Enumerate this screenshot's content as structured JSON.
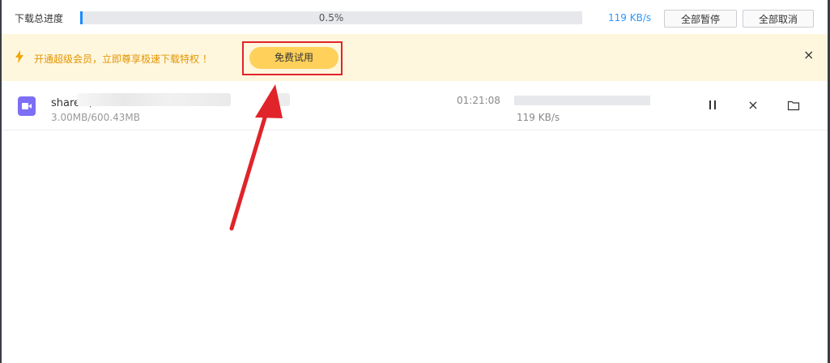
{
  "topbar": {
    "progress_label": "下载总进度",
    "progress_text": "0.5%",
    "progress_value": 0.005,
    "speed": "119 KB/s",
    "pause_all": "全部暂停",
    "cancel_all": "全部取消"
  },
  "banner": {
    "text": "开通超级会员，立即尊享极速下载特权 ！",
    "trial_button": "免费试用",
    "close": "×"
  },
  "download_row": {
    "file_name": "share                                叶 1996.mkv",
    "file_size": "3.00MB/600.43MB",
    "time_left": "01:21:08",
    "speed": "119 KB/s",
    "close": "×"
  },
  "colors": {
    "accent": "#1a8cff",
    "banner_bg": "#fff6de",
    "banner_text": "#e29600",
    "trial_button": "#ffd05a",
    "annotation": "#e0242a",
    "file_icon": "#7c6ef5"
  },
  "icons": {
    "banner": "lightning-icon",
    "file": "video-file-icon",
    "pause": "pause-icon",
    "cancel": "close-icon",
    "folder": "folder-icon"
  }
}
